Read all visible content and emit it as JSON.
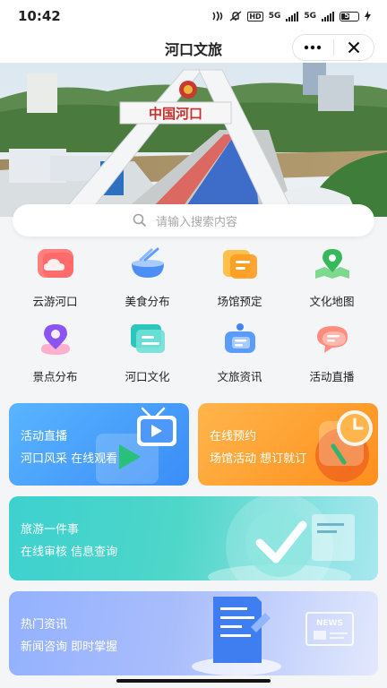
{
  "status": {
    "time": "10:42",
    "hd": "HD",
    "net1": "5G",
    "net2": "5G",
    "battery": "50",
    "battery_fraction": 0.5
  },
  "nav": {
    "title": "河口文旅"
  },
  "banner": {
    "sign_text": "中国河口"
  },
  "search": {
    "placeholder": "请输入搜索内容"
  },
  "grid": [
    {
      "label": "云游河口",
      "icon": "cloud-icon",
      "color": "#ff6b6b"
    },
    {
      "label": "美食分布",
      "icon": "food-bowl-icon",
      "color": "#4a8ff7"
    },
    {
      "label": "场馆预定",
      "icon": "venue-icon",
      "color": "#ffa52a"
    },
    {
      "label": "文化地图",
      "icon": "map-pin-icon",
      "color": "#3ec46d"
    },
    {
      "label": "景点分布",
      "icon": "location-icon",
      "color": "#9a5cf5"
    },
    {
      "label": "河口文化",
      "icon": "culture-icon",
      "color": "#2fc7c0"
    },
    {
      "label": "文旅资讯",
      "icon": "news-bell-icon",
      "color": "#3f86f5"
    },
    {
      "label": "活动直播",
      "icon": "live-chat-icon",
      "color": "#ff7a6b"
    }
  ],
  "cards": {
    "live": {
      "title": "活动直播",
      "sub": "河口风采  在线观看"
    },
    "book": {
      "title": "在线预约",
      "sub": "场馆活动  想订就订"
    },
    "tour": {
      "title": "旅游一件事",
      "sub": "在线审核  信息查询"
    },
    "news": {
      "title": "热门资讯",
      "sub": "新闻咨询  即时掌握",
      "badge": "NEWS"
    }
  }
}
